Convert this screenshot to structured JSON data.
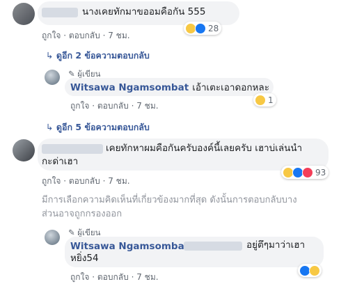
{
  "comment1": {
    "text": "นางเคยทักมาขออมคือกัน 555",
    "actions": {
      "like": "ถูกใจ",
      "reply": "ตอบกลับ",
      "time": "7 ชม."
    },
    "reaction_count": "28",
    "more_replies": "ดูอีก 2 ข้อความตอบกลับ"
  },
  "reply1": {
    "author_badge": "ผู้เขียน",
    "name": "Witsawa Ngamsombat",
    "text": "เอ้าเตะเอาดอกหละ",
    "actions": {
      "like": "ถูกใจ",
      "reply": "ตอบกลับ",
      "time": "7 ชม."
    },
    "reaction_count": "1",
    "more_replies": "ดูอีก 5 ข้อความตอบกลับ"
  },
  "comment2": {
    "text_line1": "เคยทักหาผมคือกันครับองค์นี้เลยครับ เฮาบ่เล่นนำ",
    "text_line2": "กะด่าเฮา",
    "actions": {
      "like": "ถูกใจ",
      "reply": "ตอบกลับ",
      "time": "7 ชม."
    },
    "reaction_count": "93"
  },
  "filter_notice": {
    "line1": "มีการเลือกความคิดเห็นที่เกี่ยวข้องมากที่สุด ดังนั้นการตอบกลับบาง",
    "line2": "ส่วนอาจถูกกรองออก"
  },
  "reply2": {
    "author_badge": "ผู้เขียน",
    "name": "Witsawa Ngamsombat",
    "text_line1": "อยู่ตึๆมาว่าเฮา",
    "text_line2": "หยิ่ง54",
    "actions": {
      "like": "ถูกใจ",
      "reply": "ตอบกลับ",
      "time": "7 ชม."
    }
  },
  "colors": {
    "link": "#385898",
    "bubble": "#f2f3f5",
    "meta": "#606770"
  }
}
